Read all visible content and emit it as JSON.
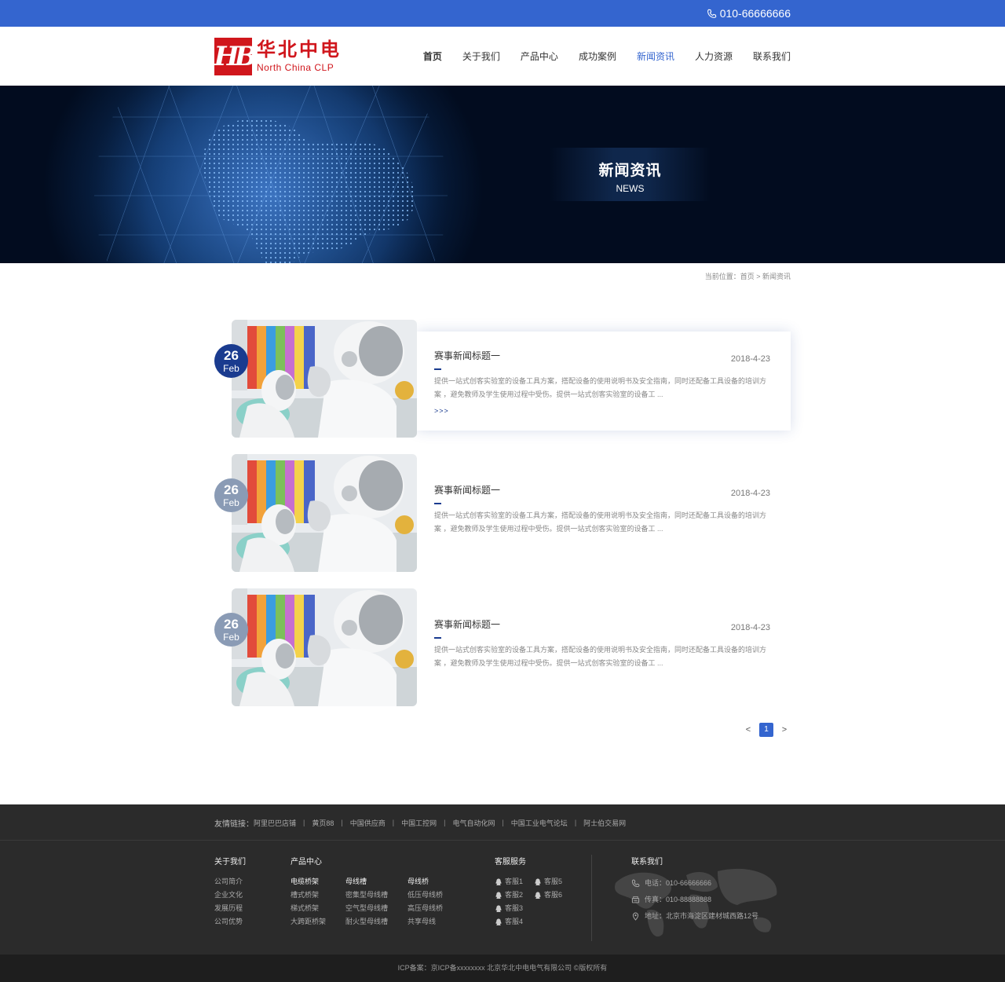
{
  "topbar": {
    "phone": "010-66666666"
  },
  "header": {
    "logo_cn": "华北中电",
    "logo_en": "North China CLP",
    "nav": [
      {
        "label": "首页"
      },
      {
        "label": "关于我们"
      },
      {
        "label": "产品中心"
      },
      {
        "label": "成功案例"
      },
      {
        "label": "新闻资讯"
      },
      {
        "label": "人力资源"
      },
      {
        "label": "联系我们"
      }
    ]
  },
  "banner": {
    "title_cn": "新闻资讯",
    "title_en": "NEWS"
  },
  "breadcrumb": "当前位置：首页 > 新闻资讯",
  "news": [
    {
      "day": "26",
      "month": "Feb",
      "title": "赛事新闻标题一",
      "date": "2018-4-23",
      "desc": "提供一站式创客实验室的设备工具方案，搭配设备的使用说明书及安全指南，同时还配备工具设备的培训方案 ，避免教师及学生使用过程中受伤。提供一站式创客实验室的设备工 ...",
      "more": ">>>"
    },
    {
      "day": "26",
      "month": "Feb",
      "title": "赛事新闻标题一",
      "date": "2018-4-23",
      "desc": "提供一站式创客实验室的设备工具方案，搭配设备的使用说明书及安全指南，同时还配备工具设备的培训方案 ，避免教师及学生使用过程中受伤。提供一站式创客实验室的设备工 ..."
    },
    {
      "day": "26",
      "month": "Feb",
      "title": "赛事新闻标题一",
      "date": "2018-4-23",
      "desc": "提供一站式创客实验室的设备工具方案，搭配设备的使用说明书及安全指南，同时还配备工具设备的培训方案 ，避免教师及学生使用过程中受伤。提供一站式创客实验室的设备工 ..."
    }
  ],
  "pager": {
    "prev": "<",
    "current": "1",
    "next": ">"
  },
  "footer": {
    "links_label": "友情链接：",
    "links": [
      "阿里巴巴店铺",
      "黄页88",
      "中国供应商",
      "中国工控网",
      "电气自动化网",
      "中国工业电气论坛",
      "阿士伯交易网"
    ],
    "about": {
      "title": "关于我们",
      "items": [
        "公司简介",
        "企业文化",
        "发展历程",
        "公司优势"
      ]
    },
    "products": {
      "title": "产品中心",
      "groups": [
        {
          "head": "电缆桥架",
          "items": [
            "槽式桥架",
            "梯式桥架",
            "大跨距桥架"
          ]
        },
        {
          "head": "母线槽",
          "items": [
            "密集型母线槽",
            "空气型母线槽",
            "耐火型母线槽"
          ]
        },
        {
          "head": "母线桥",
          "items": [
            "低压母线桥",
            "高压母线桥",
            "共享母线"
          ]
        }
      ]
    },
    "service": {
      "title": "客服服务",
      "items": [
        "客服1",
        "客服5",
        "客服2",
        "客服6",
        "客服3",
        "",
        "客服4",
        ""
      ]
    },
    "contact": {
      "title": "联系我们",
      "phone": "电话：010-66666666",
      "fax": "传真：010-88888888",
      "address": "地址：北京市海淀区建材城西路12号"
    },
    "copyright": "ICP备案：京ICP备xxxxxxxx 北京华北中电电气有限公司 ©版权所有"
  }
}
